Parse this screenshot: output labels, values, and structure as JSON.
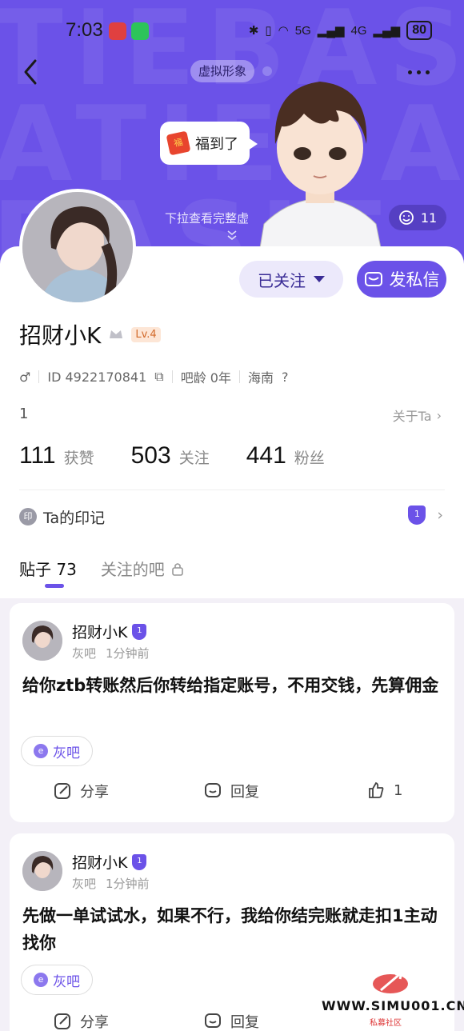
{
  "status_bar": {
    "time": "7:03",
    "net_5g": "5G",
    "net_4g": "4G",
    "battery": "80"
  },
  "header": {
    "avatar_tag": "虚拟形象",
    "bubble_text": "福到了",
    "bubble_icon_text": "福",
    "pull_hint": "下拉查看完整虚",
    "like_count": "11"
  },
  "profile": {
    "follow_label": "已关注",
    "dm_label": "发私信",
    "name": "招财小K",
    "level": "Lv.4",
    "id_text": "ID 4922170841",
    "bar_age": "吧龄 0年",
    "location": "海南",
    "signature": "1",
    "about_label": "关于Ta",
    "stats": [
      {
        "num": "111",
        "label": "获赞"
      },
      {
        "num": "503",
        "label": "关注"
      },
      {
        "num": "441",
        "label": "粉丝"
      }
    ],
    "mark_icon_text": "印",
    "mark_label": "Ta的印记",
    "medal_text": "1"
  },
  "tabs": [
    {
      "label": "贴子 73"
    },
    {
      "label": "关注的吧"
    }
  ],
  "posts": [
    {
      "author": "招财小K",
      "bar": "灰吧",
      "time": "1分钟前",
      "text": "给你ztb转账然后你转给指定账号，不用交钱，先算佣金",
      "chip": "灰吧",
      "share": "分享",
      "reply": "回复",
      "likes": "1"
    },
    {
      "author": "招财小K",
      "bar": "灰吧",
      "time": "1分钟前",
      "text": "先做一单试试水，如果不行，我给你结完账就走扣1主动找你",
      "chip": "灰吧",
      "share": "分享",
      "reply": "回复",
      "likes": ""
    }
  ],
  "watermark": {
    "text": "WWW.SIMU001.CN",
    "sub": "私募社区"
  },
  "colors": {
    "brand": "#6b52e8",
    "follow_bg": "#ece9fb",
    "level": "#d26a2b"
  },
  "icons": [
    "back-icon",
    "more-icon",
    "smile-icon",
    "chevron-down-icon",
    "mail-icon",
    "male-icon",
    "copy-icon",
    "help-icon",
    "chevron-right-icon",
    "lock-icon",
    "share-icon",
    "comment-icon",
    "thumb-up-icon"
  ]
}
